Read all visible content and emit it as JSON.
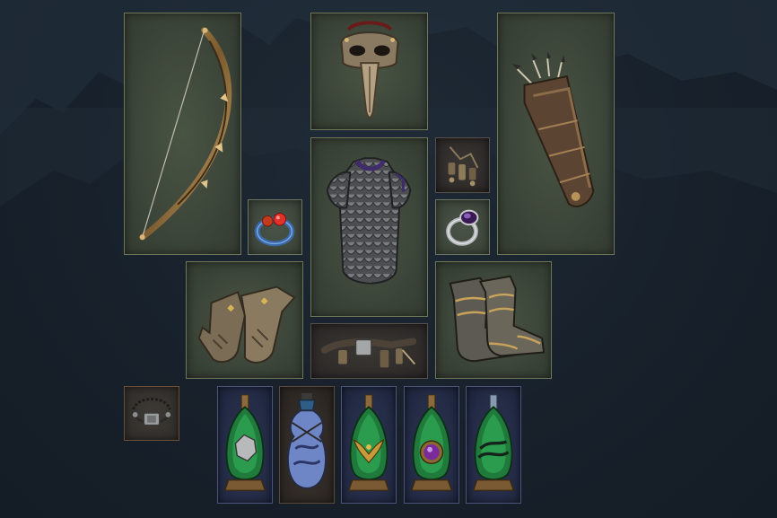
{
  "screen": "equipment-inventory",
  "colors": {
    "slot_border": "#6d7656",
    "slot_fill": "#3b4438",
    "flask_border": "#4b557c",
    "unique_border": "#6b4e35",
    "background": "#18212b"
  },
  "equipment": [
    {
      "slot": "main-hand",
      "icon": "bow-icon"
    },
    {
      "slot": "helmet",
      "icon": "plague-mask-icon"
    },
    {
      "slot": "off-hand",
      "icon": "quiver-icon"
    },
    {
      "slot": "body-armour",
      "icon": "scale-armour-icon"
    },
    {
      "slot": "left-ring",
      "icon": "ruby-ring-icon"
    },
    {
      "slot": "right-ring",
      "icon": "amethyst-ring-icon"
    },
    {
      "slot": "charm",
      "icon": "charm-icon"
    },
    {
      "slot": "gloves",
      "icon": "gauntlets-icon"
    },
    {
      "slot": "belt",
      "icon": "belt-icon"
    },
    {
      "slot": "boots",
      "icon": "greaves-icon"
    },
    {
      "slot": "amulet",
      "icon": "amulet-icon"
    }
  ],
  "flasks": [
    {
      "slot": "flask-1",
      "icon": "green-flask-stone-icon"
    },
    {
      "slot": "flask-2",
      "icon": "blue-unique-flask-icon"
    },
    {
      "slot": "flask-3",
      "icon": "green-flask-eagle-icon"
    },
    {
      "slot": "flask-4",
      "icon": "green-flask-gem-icon"
    },
    {
      "slot": "flask-5",
      "icon": "green-flask-swirl-icon"
    }
  ]
}
